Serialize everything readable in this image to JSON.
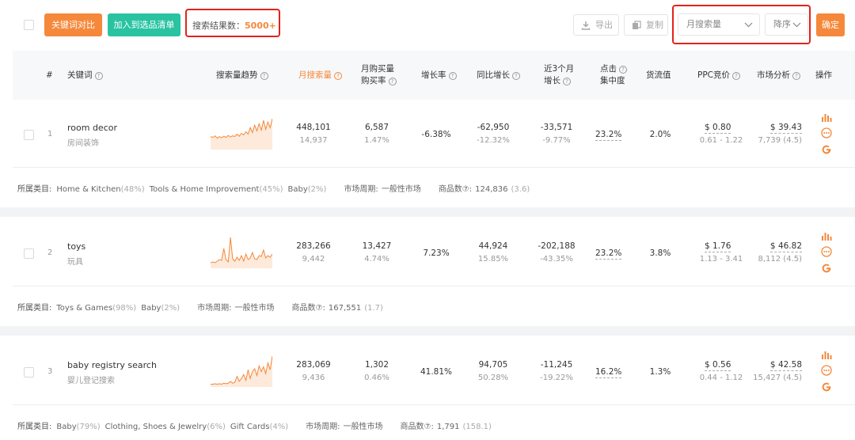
{
  "toolbar": {
    "compare_label": "关键词对比",
    "add_label": "加入到选品清单",
    "result_prefix": "搜索结果数：",
    "result_count": "5000+",
    "export_label": "导出",
    "copy_label": "复制",
    "sort_field": "月搜索量",
    "sort_order": "降序",
    "confirm_label": "确定"
  },
  "headers": {
    "index": "#",
    "keyword": "关键词",
    "trend": "搜索量趋势",
    "monthly_search": "月搜索量",
    "purchase_line1": "月购买量",
    "purchase_line2": "购买率",
    "growth": "增长率",
    "yoy": "同比增长",
    "q3_line1": "近3个月",
    "q3_line2": "增长",
    "click_line1": "点击",
    "click_line2": "集中度",
    "supply": "货流值",
    "ppc": "PPC竞价",
    "market": "市场分析",
    "ops": "操作"
  },
  "labels": {
    "category": "所属类目:",
    "cycle": "市场周期:",
    "products": "商品数⑦:"
  },
  "rows": [
    {
      "index": "1",
      "keyword": "room decor",
      "keyword_cn": "房间装饰",
      "monthly": "448,101",
      "monthly_sub": "14,937",
      "purchase": "6,587",
      "purchase_rate": "1.47%",
      "growth": "-6.38%",
      "yoy": "-62,950",
      "yoy_rate": "-12.32%",
      "q3": "-33,571",
      "q3_rate": "-9.77%",
      "click": "23.2%",
      "supply": "2.0%",
      "ppc": "$ 0.80",
      "ppc_range": "0.61 - 1.22",
      "market": "$ 39.43",
      "market_sub": "7,739 (4.5)",
      "categories": [
        {
          "name": "Home & Kitchen",
          "pct": "(48%)"
        },
        {
          "name": "Tools & Home Improvement",
          "pct": "(45%)"
        },
        {
          "name": "Baby",
          "pct": "(2%)"
        }
      ],
      "cycle": "一般性市场",
      "products": "124,836",
      "products_sub": "(3.6)",
      "trend": [
        30,
        28,
        32,
        26,
        30,
        27,
        31,
        28,
        33,
        29,
        32,
        30,
        36,
        31,
        38,
        34,
        42,
        36,
        52,
        40,
        58,
        44,
        62,
        46,
        70,
        48,
        66,
        52,
        74
      ]
    },
    {
      "index": "2",
      "keyword": "toys",
      "keyword_cn": "玩具",
      "monthly": "283,266",
      "monthly_sub": "9,442",
      "purchase": "13,427",
      "purchase_rate": "4.74%",
      "growth": "7.23%",
      "yoy": "44,924",
      "yoy_rate": "15.85%",
      "q3": "-202,188",
      "q3_rate": "-43.35%",
      "click": "23.2%",
      "supply": "3.8%",
      "ppc": "$ 1.76",
      "ppc_range": "1.13 - 3.41",
      "market": "$ 46.82",
      "market_sub": "8,112 (4.5)",
      "categories": [
        {
          "name": "Toys & Games",
          "pct": "(98%)"
        },
        {
          "name": "Baby",
          "pct": "(2%)"
        }
      ],
      "cycle": "一般性市场",
      "products": "167,551",
      "products_sub": "(1.7)",
      "trend": [
        12,
        14,
        12,
        16,
        20,
        18,
        48,
        20,
        14,
        76,
        22,
        16,
        26,
        18,
        30,
        16,
        34,
        20,
        24,
        38,
        22,
        20,
        30,
        28,
        44,
        24,
        30,
        26,
        34
      ]
    },
    {
      "index": "3",
      "keyword": "baby registry search",
      "keyword_cn": "婴儿登记搜索",
      "monthly": "283,069",
      "monthly_sub": "9,436",
      "purchase": "1,302",
      "purchase_rate": "0.46%",
      "growth": "41.81%",
      "yoy": "94,705",
      "yoy_rate": "50.28%",
      "q3": "-11,245",
      "q3_rate": "-19.22%",
      "click": "16.2%",
      "supply": "1.3%",
      "ppc": "$ 0.56",
      "ppc_range": "0.44 - 1.12",
      "market": "$ 42.58",
      "market_sub": "15,427 (4.5)",
      "categories": [
        {
          "name": "Baby",
          "pct": "(79%)"
        },
        {
          "name": "Clothing, Shoes & Jewelry",
          "pct": "(6%)"
        },
        {
          "name": "Gift Cards",
          "pct": "(4%)"
        }
      ],
      "cycle": "一般性市场",
      "products": "1,791",
      "products_sub": "(158.1)",
      "trend": [
        4,
        4,
        5,
        4,
        5,
        4,
        6,
        5,
        6,
        10,
        6,
        8,
        20,
        10,
        16,
        24,
        12,
        34,
        16,
        30,
        36,
        22,
        42,
        30,
        40,
        26,
        48,
        34,
        62
      ]
    }
  ],
  "colors": {
    "orange": "#f5883a",
    "teal": "#29c3a2",
    "highlight": "#e2231a"
  },
  "icons": {
    "export": "download-icon",
    "copy": "copy-icon",
    "chevron": "chevron-down-icon",
    "ops": [
      "bar-chart-icon",
      "more-icon",
      "google-icon"
    ]
  }
}
